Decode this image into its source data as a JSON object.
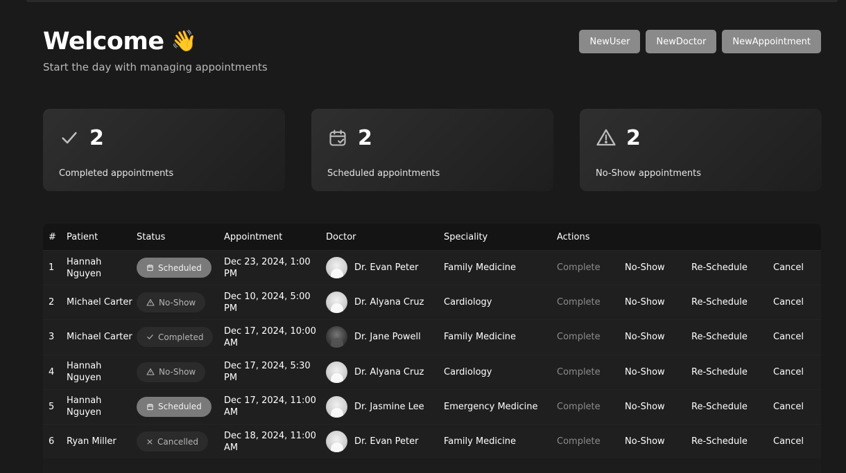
{
  "header": {
    "title": "Welcome",
    "wave": "👋",
    "subtitle": "Start the day with managing appointments"
  },
  "actions": {
    "new_user": "NewUser",
    "new_doctor": "NewDoctor",
    "new_appointment": "NewAppointment"
  },
  "stats": [
    {
      "count": "2",
      "label": "Completed appointments",
      "icon": "check-icon"
    },
    {
      "count": "2",
      "label": "Scheduled appointments",
      "icon": "calendar-check-icon"
    },
    {
      "count": "2",
      "label": "No-Show appointments",
      "icon": "warning-icon"
    }
  ],
  "table": {
    "headers": [
      "#",
      "Patient",
      "Status",
      "Appointment",
      "Doctor",
      "Speciality",
      "Actions"
    ],
    "action_labels": {
      "complete": "Complete",
      "no_show": "No-Show",
      "reschedule": "Re-Schedule",
      "cancel": "Cancel"
    },
    "rows": [
      {
        "num": "1",
        "patient": "Hannah Nguyen",
        "status": "Scheduled",
        "appointment": "Dec 23, 2024, 1:00 PM",
        "doctor": "Dr. Evan Peter",
        "speciality": "Family Medicine"
      },
      {
        "num": "2",
        "patient": "Michael Carter",
        "status": "No-Show",
        "appointment": "Dec 10, 2024, 5:00 PM",
        "doctor": "Dr. Alyana Cruz",
        "speciality": "Cardiology"
      },
      {
        "num": "3",
        "patient": "Michael Carter",
        "status": "Completed",
        "appointment": "Dec 17, 2024, 10:00 AM",
        "doctor": "Dr. Jane Powell",
        "speciality": "Family Medicine"
      },
      {
        "num": "4",
        "patient": "Hannah Nguyen",
        "status": "No-Show",
        "appointment": "Dec 17, 2024, 5:30 PM",
        "doctor": "Dr. Alyana Cruz",
        "speciality": "Cardiology"
      },
      {
        "num": "5",
        "patient": "Hannah Nguyen",
        "status": "Scheduled",
        "appointment": "Dec 17, 2024, 11:00 AM",
        "doctor": "Dr. Jasmine Lee",
        "speciality": "Emergency Medicine"
      },
      {
        "num": "6",
        "patient": "Ryan Miller",
        "status": "Cancelled",
        "appointment": "Dec 18, 2024, 11:00 AM",
        "doctor": "Dr. Evan Peter",
        "speciality": "Family Medicine"
      }
    ]
  }
}
